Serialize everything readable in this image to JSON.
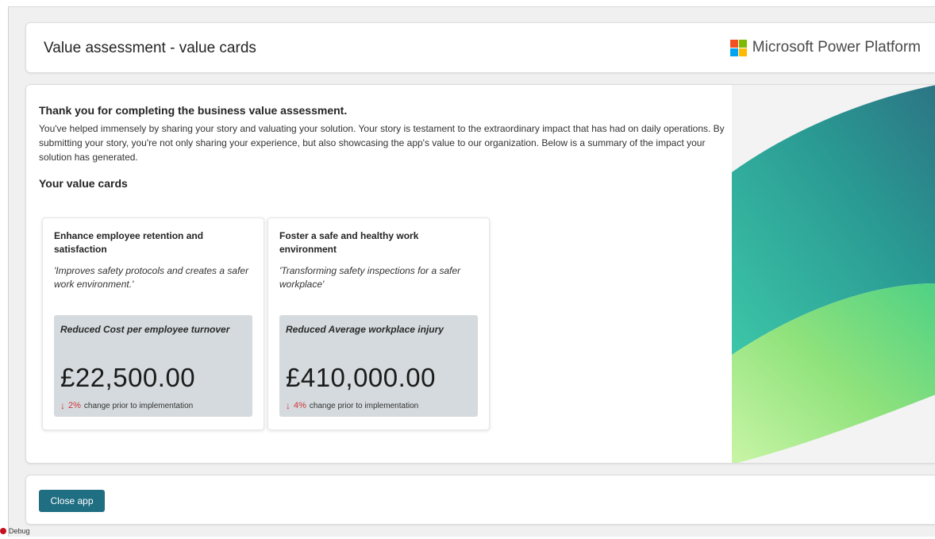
{
  "header": {
    "title": "Value assessment - value cards",
    "brand": "Microsoft Power Platform"
  },
  "intro": {
    "title": "Thank you for completing the business value assessment.",
    "body": "You've helped immensely by sharing your story and valuating your solution. Your story is testament to the extraordinary impact that  has had on daily operations. By submitting your story, you're not only sharing your experience, but also showcasing the app's value to our organization. Below is a summary of the impact your solution has generated."
  },
  "cards_section": {
    "title": "Your value cards",
    "cards": [
      {
        "title": "Enhance employee retention and satisfaction",
        "quote": "'Improves safety protocols and creates a safer work environment.'",
        "metric_label": "Reduced Cost per employee turnover",
        "metric_value": "£22,500.00",
        "change_arrow": "↓",
        "change_pct": "2%",
        "change_text": "change prior to implementation"
      },
      {
        "title": "Foster a safe and healthy work environment",
        "quote": "'Transforming safety inspections for a safer workplace'",
        "metric_label": "Reduced Average workplace injury",
        "metric_value": "£410,000.00",
        "change_arrow": "↓",
        "change_pct": "4%",
        "change_text": "change prior to implementation"
      }
    ]
  },
  "footer": {
    "close_label": "Close app"
  },
  "debug": {
    "label": "Debug"
  },
  "colors": {
    "accent": "#1f6e82",
    "negative": "#d13438",
    "metric_bg": "#d4dadd"
  },
  "icons": {
    "brand": "microsoft-logo-icon",
    "change": "arrow-down-icon",
    "debug": "record-dot-icon"
  }
}
